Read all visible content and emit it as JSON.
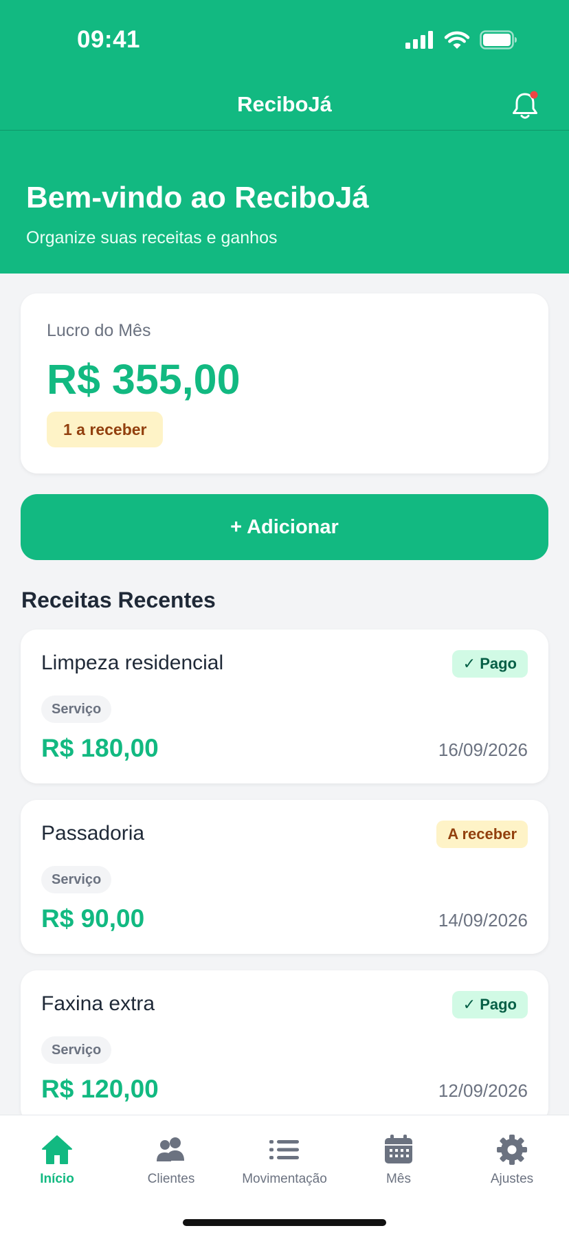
{
  "status_bar": {
    "time": "09:41"
  },
  "header": {
    "title": "ReciboJá"
  },
  "hero": {
    "title": "Bem-vindo ao ReciboJá",
    "subtitle": "Organize suas receitas e ganhos"
  },
  "summary": {
    "label": "Lucro do Mês",
    "value": "R$ 355,00",
    "pending_badge": "1 a receber"
  },
  "add_button": {
    "label": "+ Adicionar"
  },
  "recent": {
    "title": "Receitas Recentes",
    "items": [
      {
        "title": "Limpeza residencial",
        "status": "✓ Pago",
        "type": "Serviço",
        "amount": "R$ 180,00",
        "date": "16/09/2026"
      },
      {
        "title": "Passadoria",
        "status": "A receber",
        "type": "Serviço",
        "amount": "R$ 90,00",
        "date": "14/09/2026"
      },
      {
        "title": "Faxina extra",
        "status": "✓ Pago",
        "type": "Serviço",
        "amount": "R$ 120,00",
        "date": "12/09/2026"
      }
    ]
  },
  "tabs": [
    {
      "label": "Início",
      "icon": "home-icon",
      "active": true
    },
    {
      "label": "Clientes",
      "icon": "users-icon"
    },
    {
      "label": "Movimentação",
      "icon": "list-icon"
    },
    {
      "label": "Mês",
      "icon": "calendar-icon"
    },
    {
      "label": "Ajustes",
      "icon": "gear-icon"
    }
  ],
  "colors": {
    "brand": "#12b981",
    "paid_bg": "#d1fae5",
    "pending_bg": "#fef3c7",
    "pending_text": "#92400e",
    "notification_dot": "#ef4444"
  }
}
